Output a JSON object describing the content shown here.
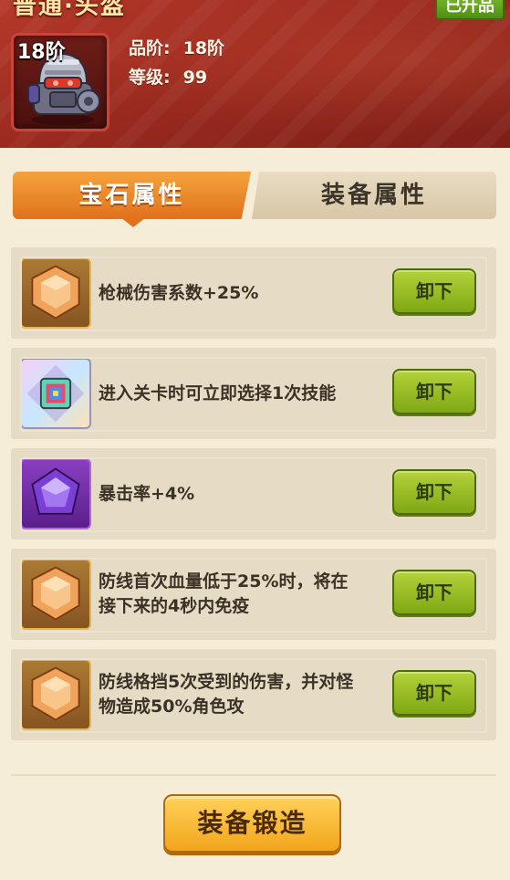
{
  "header": {
    "title": "普通·头盔",
    "upgraded_badge": "已升品",
    "item_stage": "18阶",
    "item_icon": "mech-helmet-icon",
    "grade_label": "品阶:",
    "grade_value": "18阶",
    "level_label": "等级:",
    "level_value": "99"
  },
  "tabs": [
    {
      "label": "宝石属性",
      "active": true
    },
    {
      "label": "装备属性",
      "active": false
    }
  ],
  "gems": [
    {
      "icon": "orange-hexagon-gem-icon",
      "color": "#f0a35a",
      "description": "枪械伤害系数+25%",
      "button": "卸下"
    },
    {
      "icon": "rainbow-square-gem-icon",
      "color": "#6fd0c0",
      "description": "进入关卡时可立即选择1次技能",
      "button": "卸下"
    },
    {
      "icon": "purple-pentagon-gem-icon",
      "color": "#7b3fd6",
      "description": "暴击率+4%",
      "button": "卸下"
    },
    {
      "icon": "orange-hexagon-gem-icon",
      "color": "#f0a35a",
      "description": "防线首次血量低于25%时，将在接下来的4秒内免疫",
      "button": "卸下"
    },
    {
      "icon": "orange-hexagon-gem-icon",
      "color": "#f0a35a",
      "description": "防线格挡5次受到的伤害，并对怪物造成50%角色攻",
      "button": "卸下"
    }
  ],
  "footer": {
    "forge_button": "装备锻造"
  },
  "colors": {
    "header_red": "#9b2a1f",
    "tab_active": "#e0711d",
    "button_green": "#8fb81e",
    "forge_orange": "#f3a51c"
  }
}
